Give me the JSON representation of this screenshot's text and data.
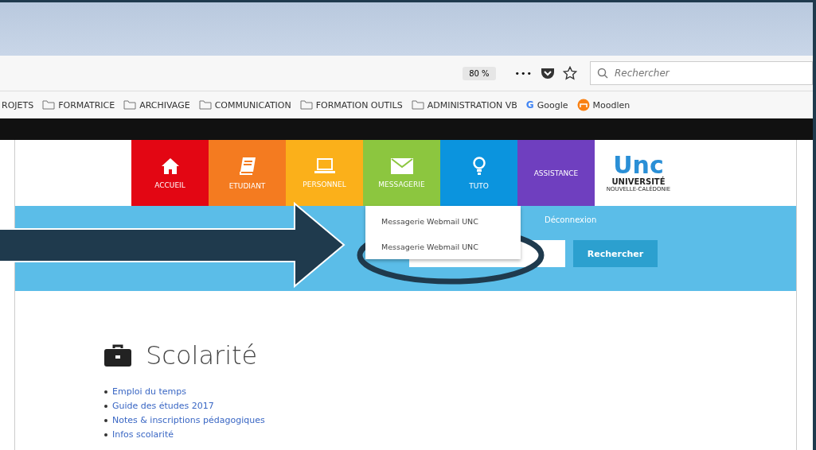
{
  "toolbar": {
    "zoom": "80 %",
    "menu": "•••",
    "search_placeholder": "Rechercher"
  },
  "bookmarks": [
    {
      "label": "ROJETS",
      "kind": "text"
    },
    {
      "label": "FORMATRICE",
      "kind": "folder"
    },
    {
      "label": "ARCHIVAGE",
      "kind": "folder"
    },
    {
      "label": "COMMUNICATION",
      "kind": "folder"
    },
    {
      "label": "FORMATION OUTILS",
      "kind": "folder"
    },
    {
      "label": "ADMINISTRATION VB",
      "kind": "folder"
    },
    {
      "label": "Google",
      "kind": "google",
      "icon_text": "G"
    },
    {
      "label": "Moodlen",
      "kind": "moodle"
    }
  ],
  "nav": [
    {
      "label": "ACCUEIL",
      "kind": "home",
      "color": "#e30613"
    },
    {
      "label": "ETUDIANT",
      "kind": "book",
      "color": "#f47b20"
    },
    {
      "label": "PERSONNEL",
      "kind": "laptop",
      "color": "#fbb01a"
    },
    {
      "label": "MESSAGERIE",
      "kind": "mail",
      "color": "#8cc63f"
    },
    {
      "label": "TUTO",
      "kind": "bulb",
      "color": "#0b94de"
    },
    {
      "label": "ASSISTANCE",
      "kind": "none",
      "color": "#6f3fbf"
    }
  ],
  "logo": {
    "mark": "Unc",
    "name": "UNIVERSITÉ",
    "sub": "NOUVELLE-CALÉDONIE"
  },
  "dropdown": [
    "Messagerie Webmail UNC",
    "Messagerie Webmail UNC"
  ],
  "logout": "Déconnexion",
  "search_button": "Rechercher",
  "section": {
    "title": "Scolarité",
    "links": [
      "Emploi du temps",
      "Guide des études 2017",
      "Notes & inscriptions pédagogiques",
      "Infos scolarité"
    ]
  }
}
